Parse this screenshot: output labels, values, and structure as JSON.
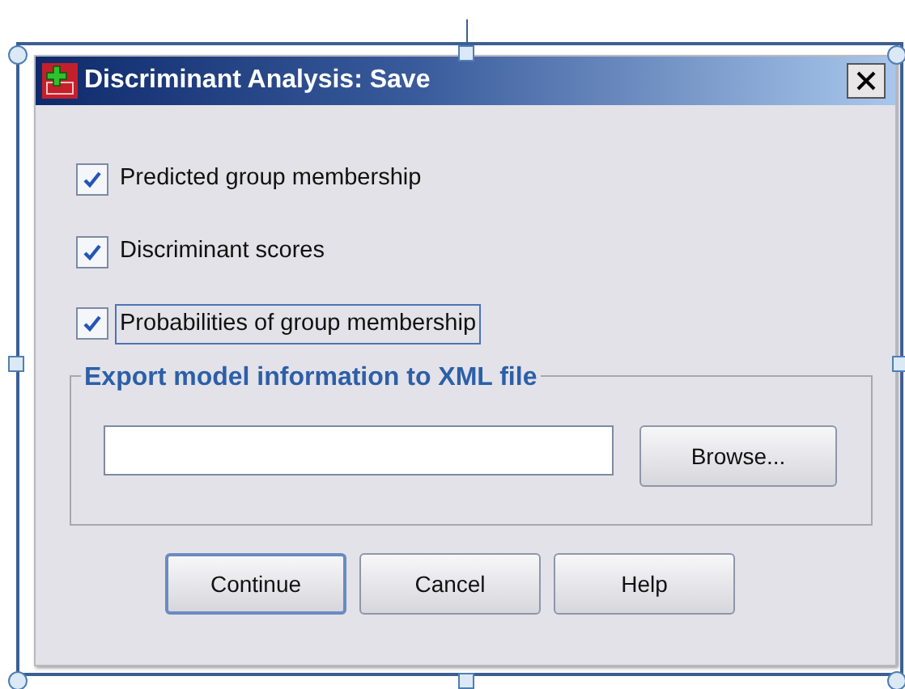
{
  "window": {
    "title": "Discriminant Analysis: Save"
  },
  "checkboxes": [
    {
      "label": "Predicted group membership",
      "checked": true,
      "focused": false
    },
    {
      "label": "Discriminant scores",
      "checked": true,
      "focused": false
    },
    {
      "label": "Probabilities of group membership",
      "checked": true,
      "focused": true
    }
  ],
  "export_group": {
    "title": "Export model information to XML file",
    "browse_button": "Browse..."
  },
  "buttons": [
    {
      "label": "Continue",
      "default": true
    },
    {
      "label": "Cancel",
      "default": false
    },
    {
      "label": "Help",
      "default": false
    }
  ]
}
